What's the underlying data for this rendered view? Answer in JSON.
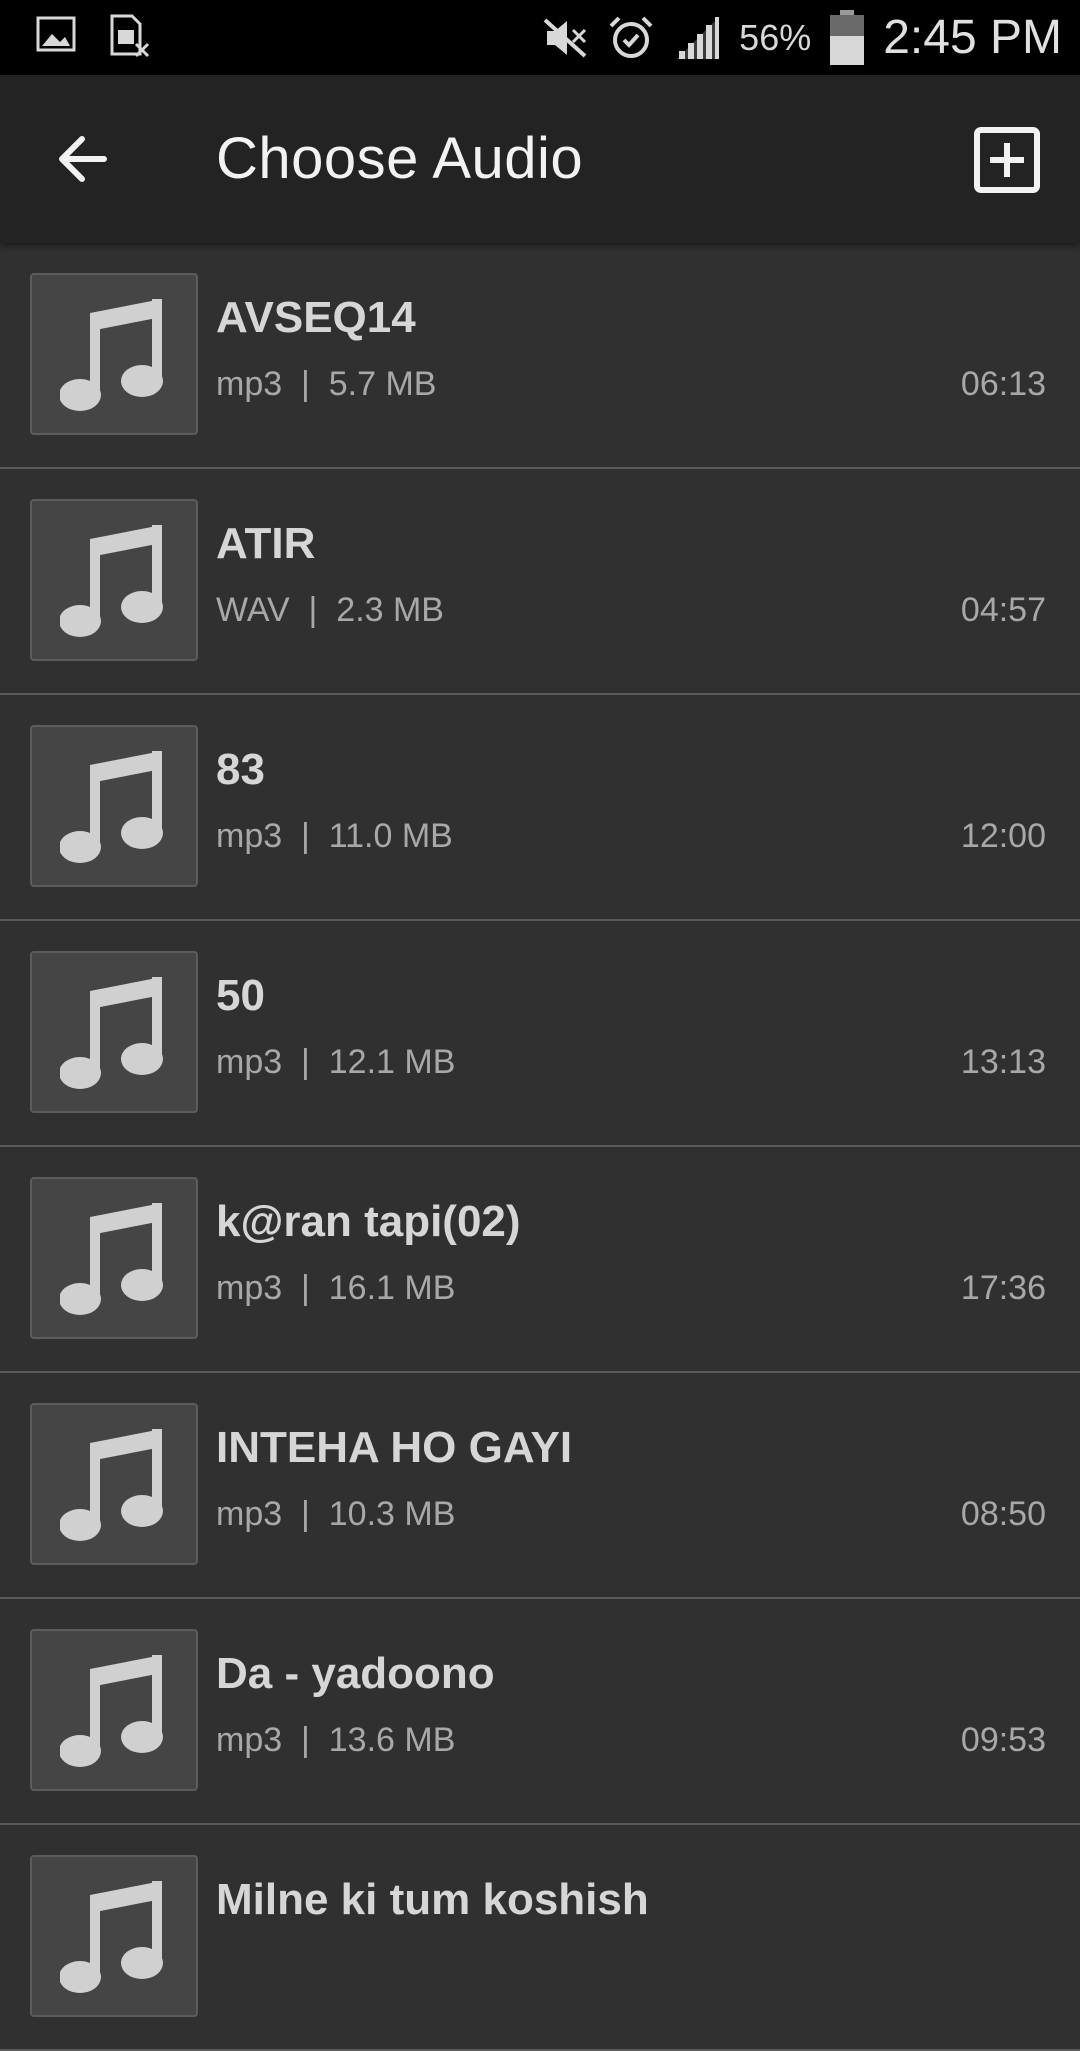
{
  "status_bar": {
    "battery_percent": "56%",
    "time": "2:45 PM",
    "icons": [
      "gallery-icon",
      "sim-error-icon",
      "mute-icon",
      "alarm-icon",
      "signal-icon",
      "battery-icon"
    ]
  },
  "app_bar": {
    "title": "Choose Audio",
    "back_icon": "arrow-left-icon",
    "add_icon": "add-box-icon"
  },
  "audio_files": [
    {
      "name": "AVSEQ14",
      "format": "mp3",
      "size": "5.7 MB",
      "duration": "06:13"
    },
    {
      "name": "ATIR",
      "format": "WAV",
      "size": "2.3 MB",
      "duration": "04:57"
    },
    {
      "name": "83",
      "format": "mp3",
      "size": "11.0 MB",
      "duration": "12:00"
    },
    {
      "name": "50",
      "format": "mp3",
      "size": "12.1 MB",
      "duration": "13:13"
    },
    {
      "name": "k@ran tapi(02)",
      "format": "mp3",
      "size": "16.1 MB",
      "duration": "17:36"
    },
    {
      "name": "INTEHA HO GAYI",
      "format": "mp3",
      "size": "10.3 MB",
      "duration": "08:50"
    },
    {
      "name": "Da - yadoono",
      "format": "mp3",
      "size": "13.6 MB",
      "duration": "09:53"
    },
    {
      "name": "Milne ki tum koshish",
      "format": "",
      "size": "",
      "duration": ""
    }
  ],
  "colors": {
    "background": "#303030",
    "app_bar": "#232323",
    "status_bar": "#000000",
    "title_text": "#f2f2f2",
    "name_text": "#d6d6d6",
    "meta_text": "#a8a8a8",
    "divider": "#5a5a5a"
  }
}
